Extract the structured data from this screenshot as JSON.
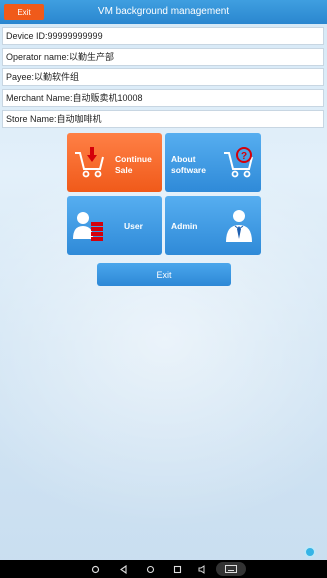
{
  "header": {
    "exit_label": "Exit",
    "title": "VM background management"
  },
  "info": {
    "device_id": "Device ID:99999999999",
    "operator": "Operator name:以勤生产部",
    "payee": "Payee:以勤软件组",
    "merchant": "Merchant Name:自动贩卖机10008",
    "store": "Store Name:自动咖啡机"
  },
  "menu": {
    "continue_line1": "Continue",
    "continue_line2": "Sale",
    "about_line1": "About",
    "about_line2": "software",
    "user": "User",
    "admin": "Admin"
  },
  "footer": {
    "exit_label": "Exit"
  },
  "colors": {
    "top_bar": "#2a86cf",
    "exit_top": "#f05a1a",
    "tile_orange": "#f05a1a",
    "tile_blue": "#2f8ad8"
  },
  "icons": {
    "continue": "cart-down-arrow-icon",
    "about": "cart-question-icon",
    "user": "user-stack-icon",
    "admin": "admin-person-icon"
  }
}
